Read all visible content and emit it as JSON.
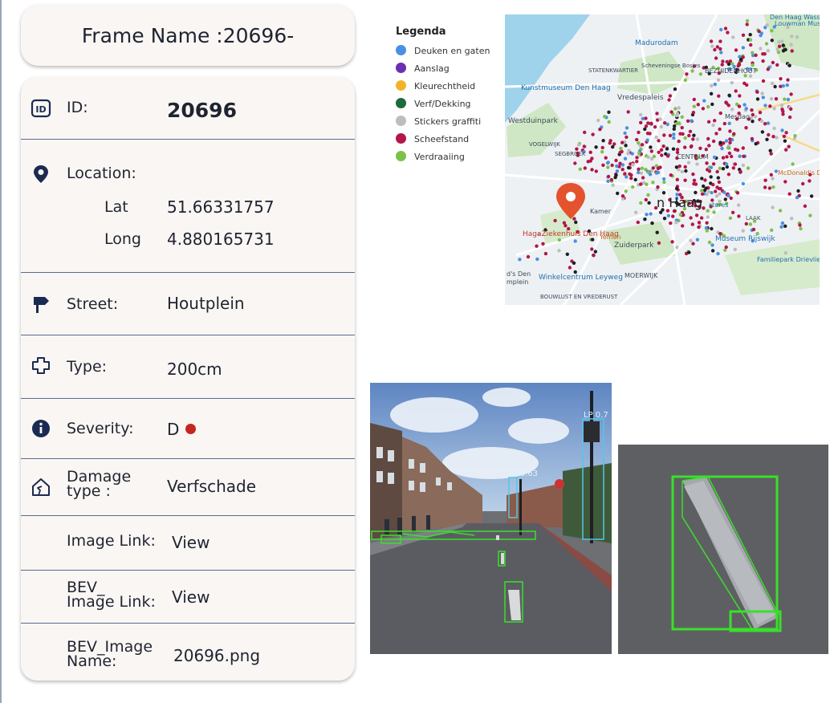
{
  "frame": {
    "title": "Frame Name :20696-"
  },
  "details": {
    "id_label": "ID:",
    "id_value": "20696",
    "location_label": "Location:",
    "lat_label": "Lat",
    "lat_value": "51.66331757",
    "long_label": "Long",
    "long_value": "4.880165731",
    "street_label": "Street:",
    "street_value": "Houtplein",
    "type_label": "Type:",
    "type_value": "200cm",
    "severity_label": "Severity:",
    "severity_value": "D",
    "severity_color": "#c4271f",
    "damage_label_line1": "Damage",
    "damage_label_line2": "type :",
    "damage_value": "Verfschade",
    "image_link_label": "Image Link:",
    "image_link_value": "View",
    "bev_link_label_line1": "BEV_",
    "bev_link_label_line2": "Image Link:",
    "bev_link_value": "View",
    "bev_name_label_line1": "BEV_Image",
    "bev_name_label_line2": "Name:",
    "bev_name_value": "20696.png"
  },
  "map": {
    "legend_title": "Legenda",
    "legend_items": [
      {
        "label": "Deuken en gaten",
        "color": "#4a90e2"
      },
      {
        "label": "Aanslag",
        "color": "#6b2fb0"
      },
      {
        "label": "Kleurechtheid",
        "color": "#f0b428"
      },
      {
        "label": "Verf/Dekking",
        "color": "#1d6b3a"
      },
      {
        "label": "Stickers graffiti",
        "color": "#bdbdbd"
      },
      {
        "label": "Scheefstand",
        "color": "#b3164a"
      },
      {
        "label": "Verdraaiing",
        "color": "#7cc24a"
      }
    ],
    "place_labels": {
      "haag": "n Haag",
      "madurodam": "Madurodam",
      "kunstmuseum": "Kunstmuseum Den Haag",
      "vredespaleis": "Vredespaleis",
      "westduinpark": "Westduinpark",
      "zuiderpark": "Zuiderpark",
      "moerwijk": "MOERWIJK",
      "winkelcentrum": "Winkelcentrum Leyweg",
      "museum_rijswijk": "Museum Rijswijk",
      "hagaziekenhuis": "HagaZiekenhuis Den Haag",
      "bezuidenhout": "BEZUIDENHOUT",
      "scheveningse": "Scheveningse Bosjes",
      "mcdonalds": "McDonald's D Haag Binckhor",
      "familiepark": "Familiepark Drievlie",
      "centrum": "CENTRUM",
      "laakhaven": "LAAK",
      "bouwlust": "BOUWLUST EN VREDERUST",
      "louwman": "Louwman Museur",
      "den_haag_top": "Den Haag Wasse",
      "segbroek": "SEGBROEK",
      "statenkwartier": "STATENKWARTIER",
      "vogelwijk": "VOGELWIJK",
      "stores": "stores",
      "mesdag": "Mesdag",
      "kamer": "Kamer",
      "yemen": "Yemen",
      "ds_den": "d's Den",
      "mplein": "mplein"
    }
  },
  "camera": {
    "label_a": "LP 0.7",
    "label_b": "LP 0.63"
  },
  "colors": {
    "card_bg": "#faf6f4",
    "separator": "#5b6a8e",
    "icon_dark": "#1b2a52",
    "map_pin": "#e4532d",
    "detection_green": "#39e02b",
    "detection_cyan": "#53c7e6"
  }
}
